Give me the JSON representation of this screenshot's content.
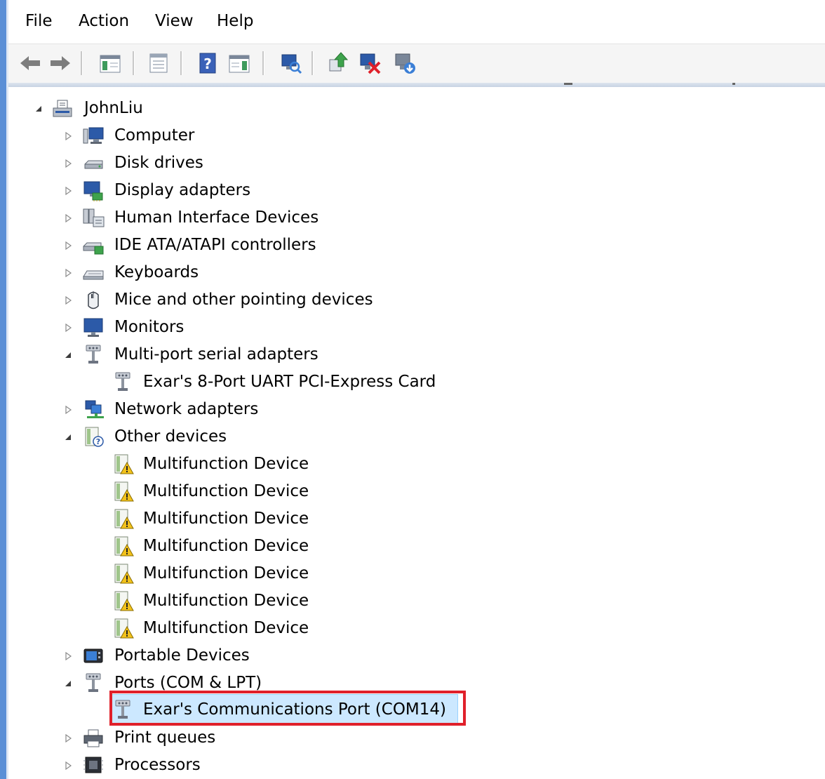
{
  "menu": {
    "file": "File",
    "action": "Action",
    "view": "View",
    "help": "Help"
  },
  "toolbar": {
    "buttons": [
      "back-icon",
      "forward-icon",
      "show-hide-console-tree-icon",
      "properties-icon",
      "help-icon",
      "show-action-pane-icon",
      "scan-hardware-changes-icon",
      "update-driver-icon",
      "disable-device-icon",
      "uninstall-device-icon"
    ]
  },
  "tree": {
    "root": "JohnLiu",
    "computer": "Computer",
    "disk_drives": "Disk drives",
    "display_adapters": "Display adapters",
    "hid": "Human Interface Devices",
    "ide": "IDE ATA/ATAPI controllers",
    "keyboards": "Keyboards",
    "mice": "Mice and other pointing devices",
    "monitors": "Monitors",
    "multiport": "Multi-port serial adapters",
    "exar_card": "Exar's 8-Port UART PCI-Express Card",
    "network": "Network adapters",
    "other": "Other devices",
    "multifunction": [
      "Multifunction Device",
      "Multifunction Device",
      "Multifunction Device",
      "Multifunction Device",
      "Multifunction Device",
      "Multifunction Device",
      "Multifunction Device"
    ],
    "portable": "Portable Devices",
    "ports": "Ports (COM & LPT)",
    "exar_port": "Exar's Communications Port (COM14)",
    "print_queues": "Print queues",
    "processors": "Processors"
  },
  "colors": {
    "selection": "#cce8ff",
    "highlight_border": "#e0202a",
    "window_accent": "#5b8fd6",
    "warning": "#f3c21b"
  }
}
